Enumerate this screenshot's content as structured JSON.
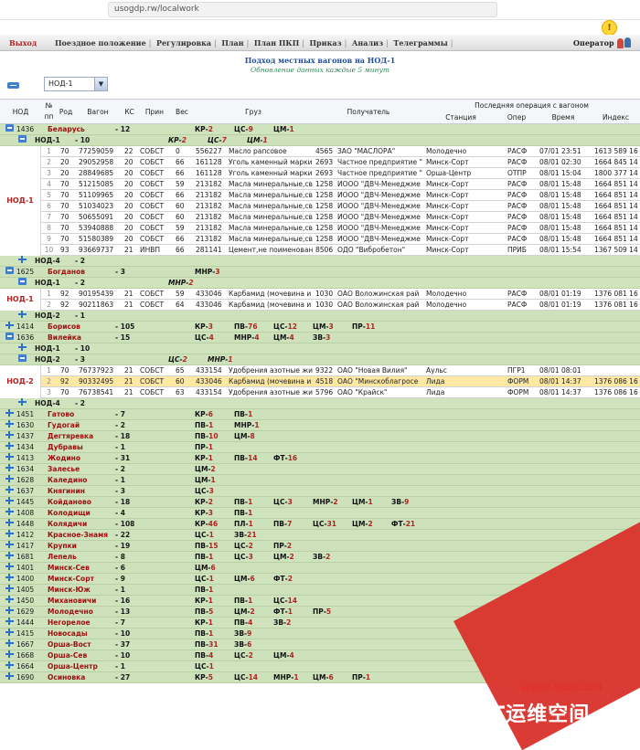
{
  "browser": {
    "url": "usogdp.rw/localwork"
  },
  "menu": {
    "exit": "Выход",
    "items": [
      "Поездное положение",
      "Регулировка",
      "План",
      "План ПКП",
      "Приказ",
      "Анализ",
      "Телеграммы"
    ],
    "operator": "Оператор"
  },
  "page": {
    "title": "Подход местных вагонов на НОД-1",
    "subtitle": "Обновление данных каждые 5 минут",
    "select_value": "НОД-1"
  },
  "table": {
    "headers": {
      "nod": "НОД",
      "no_line1": "№",
      "no_line2": "пп",
      "rod": "Род",
      "wagon": "Вагон",
      "ks": "КС",
      "prin": "Прин",
      "ves": "Вес",
      "gruz": "Груз",
      "recipient": "Получатель",
      "last_op": "Последняя операция с вагоном",
      "station": "Станция",
      "oper": "Опер",
      "time": "Время",
      "index": "Индекс"
    },
    "root": {
      "code": "1436",
      "name": "Беларусь",
      "count": "12",
      "codes": [
        [
          "КР",
          "2"
        ],
        [
          "ЦС",
          "9"
        ],
        [
          "ЦМ",
          "1"
        ]
      ]
    },
    "nod1": [
      {
        "label": "НОД-1",
        "count": "10",
        "codes": [
          [
            "КР",
            "2"
          ],
          [
            "ЦС",
            "7"
          ],
          [
            "ЦМ",
            "1"
          ]
        ],
        "expanded": true,
        "wagons": [
          {
            "n": "1",
            "rod": "70",
            "wagon": "77259059",
            "ks": "22",
            "prin": "СОБСТ",
            "ves": "0",
            "cargo_code": "556227",
            "cargo": "Масло рапсовое",
            "rcp_code": "4565",
            "recipient": "ЗАО \"МАСЛОРА\"",
            "station": "Молодечно",
            "op": "РАСФ",
            "time": "07/01 23:51",
            "index": "1613 589 16"
          },
          {
            "n": "2",
            "rod": "20",
            "wagon": "29052958",
            "ks": "20",
            "prin": "СОБСТ",
            "ves": "66",
            "cargo_code": "161128",
            "cargo": "Уголь каменный марки",
            "rcp_code": "2693",
            "recipient": "Частное предприятие \"",
            "station": "Минск-Сорт",
            "op": "РАСФ",
            "time": "08/01 02:30",
            "index": "1664 845 14"
          },
          {
            "n": "3",
            "rod": "20",
            "wagon": "28849685",
            "ks": "20",
            "prin": "СОБСТ",
            "ves": "66",
            "cargo_code": "161128",
            "cargo": "Уголь каменный марки",
            "rcp_code": "2693",
            "recipient": "Частное предприятие \"",
            "station": "Орша-Центр",
            "op": "ОТПР",
            "time": "08/01 15:04",
            "index": "1800 377 14"
          },
          {
            "n": "4",
            "rod": "70",
            "wagon": "51215085",
            "ks": "20",
            "prin": "СОБСТ",
            "ves": "59",
            "cargo_code": "213182",
            "cargo": "Масла минеральные,св",
            "rcp_code": "1258",
            "recipient": "ИООО \"ДВЧ-Менеджме",
            "station": "Минск-Сорт",
            "op": "РАСФ",
            "time": "08/01 15:48",
            "index": "1664 851 14"
          },
          {
            "n": "5",
            "rod": "70",
            "wagon": "51109965",
            "ks": "20",
            "prin": "СОБСТ",
            "ves": "66",
            "cargo_code": "213182",
            "cargo": "Масла минеральные,св",
            "rcp_code": "1258",
            "recipient": "ИООО \"ДВЧ-Менеджме",
            "station": "Минск-Сорт",
            "op": "РАСФ",
            "time": "08/01 15:48",
            "index": "1664 851 14"
          },
          {
            "n": "6",
            "rod": "70",
            "wagon": "51034023",
            "ks": "20",
            "prin": "СОБСТ",
            "ves": "60",
            "cargo_code": "213182",
            "cargo": "Масла минеральные,св",
            "rcp_code": "1258",
            "recipient": "ИООО \"ДВЧ-Менеджме",
            "station": "Минск-Сорт",
            "op": "РАСФ",
            "time": "08/01 15:48",
            "index": "1664 851 14"
          },
          {
            "n": "7",
            "rod": "70",
            "wagon": "50655091",
            "ks": "20",
            "prin": "СОБСТ",
            "ves": "60",
            "cargo_code": "213182",
            "cargo": "Масла минеральные,св",
            "rcp_code": "1258",
            "recipient": "ИООО \"ДВЧ-Менеджме",
            "station": "Минск-Сорт",
            "op": "РАСФ",
            "time": "08/01 15:48",
            "index": "1664 851 14"
          },
          {
            "n": "8",
            "rod": "70",
            "wagon": "53940888",
            "ks": "20",
            "prin": "СОБСТ",
            "ves": "59",
            "cargo_code": "213182",
            "cargo": "Масла минеральные,св",
            "rcp_code": "1258",
            "recipient": "ИООО \"ДВЧ-Менеджме",
            "station": "Минск-Сорт",
            "op": "РАСФ",
            "time": "08/01 15:48",
            "index": "1664 851 14"
          },
          {
            "n": "9",
            "rod": "70",
            "wagon": "51580389",
            "ks": "20",
            "prin": "СОБСТ",
            "ves": "66",
            "cargo_code": "213182",
            "cargo": "Масла минеральные,св",
            "rcp_code": "1258",
            "recipient": "ИООО \"ДВЧ-Менеджме",
            "station": "Минск-Сорт",
            "op": "РАСФ",
            "time": "08/01 15:48",
            "index": "1664 851 14"
          },
          {
            "n": "10",
            "rod": "93",
            "wagon": "93669737",
            "ks": "21",
            "prin": "ИНВП",
            "ves": "66",
            "cargo_code": "281141",
            "cargo": "Цемент,не поименован",
            "rcp_code": "8506",
            "recipient": "ОДО \"Вибробетон\"",
            "station": "Минск-Сорт",
            "op": "ПРИБ",
            "time": "08/01 15:54",
            "index": "1367 509 14"
          }
        ]
      },
      {
        "label": "НОД-4",
        "count": "2",
        "expanded": false
      }
    ],
    "bogdanov": {
      "code": "1625",
      "name": "Богданов",
      "count": "3",
      "codes": [
        [
          "МНР",
          "3"
        ]
      ]
    },
    "nod1b": [
      {
        "label": "НОД-1",
        "count": "2",
        "codes": [
          [
            "МНР",
            "2"
          ]
        ],
        "expanded": true,
        "wagons": [
          {
            "n": "1",
            "rod": "92",
            "wagon": "90195439",
            "ks": "21",
            "prin": "СОБСТ",
            "ves": "59",
            "cargo_code": "433046",
            "cargo": "Карбамид (мочевина и",
            "rcp_code": "1030",
            "recipient": "ОАО Воложинская рай",
            "station": "Молодечно",
            "op": "РАСФ",
            "time": "08/01 01:19",
            "index": "1376 081 16"
          },
          {
            "n": "2",
            "rod": "92",
            "wagon": "90211863",
            "ks": "21",
            "prin": "СОБСТ",
            "ves": "64",
            "cargo_code": "433046",
            "cargo": "Карбамид (мочевина и",
            "rcp_code": "1030",
            "recipient": "ОАО Воложинская рай",
            "station": "Молодечно",
            "op": "РАСФ",
            "time": "08/01 01:19",
            "index": "1376 081 16"
          }
        ]
      },
      {
        "label": "НОД-2",
        "count": "1",
        "expanded": false
      }
    ],
    "borisov": [
      {
        "code": "1414",
        "name": "Борисов",
        "count": "105",
        "codes": [
          [
            "КР",
            "3"
          ],
          [
            "ПВ",
            "76"
          ],
          [
            "ЦС",
            "12"
          ],
          [
            "ЦМ",
            "3"
          ],
          [
            "ПР",
            "11"
          ]
        ]
      },
      {
        "code": "1636",
        "name": "Вилейка",
        "count": "15",
        "codes": [
          [
            "ЦС",
            "4"
          ],
          [
            "МНР",
            "4"
          ],
          [
            "ЦМ",
            "4"
          ],
          [
            "ЗВ",
            "3"
          ]
        ]
      }
    ],
    "nod1c": {
      "label": "НОД-1",
      "count": "10"
    },
    "nod2": {
      "label": "НОД-2",
      "count": "3",
      "codes": [
        [
          "ЦС",
          "2"
        ],
        [
          "МНР",
          "1"
        ]
      ],
      "side": "НОД-2",
      "wagons": [
        {
          "n": "1",
          "rod": "70",
          "wagon": "76737923",
          "ks": "21",
          "prin": "СОБСТ",
          "ves": "65",
          "cargo_code": "433154",
          "cargo": "Удобрения азотные жи",
          "rcp_code": "9322",
          "recipient": "ОАО \"Новая Вилия\"",
          "station": "Аульс",
          "op": "ПГР1",
          "time": "08/01 08:01",
          "index": ""
        },
        {
          "n": "2",
          "rod": "92",
          "wagon": "90332495",
          "ks": "21",
          "prin": "СОБСТ",
          "ves": "60",
          "cargo_code": "433046",
          "cargo": "Карбамид (мочевина и",
          "rcp_code": "4518",
          "recipient": "ОАО \"Минскоблагросе",
          "station": "Лида",
          "op": "ФОРМ",
          "time": "08/01 14:37",
          "index": "1376 086 16",
          "highlight": true
        },
        {
          "n": "3",
          "rod": "70",
          "wagon": "76738541",
          "ks": "21",
          "prin": "СОБСТ",
          "ves": "63",
          "cargo_code": "433154",
          "cargo": "Удобрения азотные жи",
          "rcp_code": "5796",
          "recipient": "ОАО \"Крайск\"",
          "station": "Лида",
          "op": "ФОРМ",
          "time": "08/01 14:37",
          "index": "1376 086 16"
        }
      ]
    },
    "nod4b": {
      "label": "НОД-4",
      "count": "2"
    },
    "stations": [
      {
        "code": "1451",
        "name": "Гатово",
        "count": "7",
        "codes": [
          [
            "КР",
            "6"
          ],
          [
            "ПВ",
            "1"
          ]
        ]
      },
      {
        "code": "1630",
        "name": "Гудогай",
        "count": "2",
        "codes": [
          [
            "ПВ",
            "1"
          ],
          [
            "МНР",
            "1"
          ]
        ]
      },
      {
        "code": "1437",
        "name": "Дегтяревка",
        "count": "18",
        "codes": [
          [
            "ПВ",
            "10"
          ],
          [
            "ЦМ",
            "8"
          ]
        ]
      },
      {
        "code": "1434",
        "name": "Дубравы",
        "count": "1",
        "codes": [
          [
            "ПР",
            "1"
          ]
        ]
      },
      {
        "code": "1413",
        "name": "Жодино",
        "count": "31",
        "codes": [
          [
            "КР",
            "1"
          ],
          [
            "ПВ",
            "14"
          ],
          [
            "ФТ",
            "16"
          ]
        ]
      },
      {
        "code": "1634",
        "name": "Залесье",
        "count": "2",
        "codes": [
          [
            "ЦМ",
            "2"
          ]
        ]
      },
      {
        "code": "1628",
        "name": "Каледино",
        "count": "1",
        "codes": [
          [
            "ЦМ",
            "1"
          ]
        ]
      },
      {
        "code": "1637",
        "name": "Княгинин",
        "count": "3",
        "codes": [
          [
            "ЦС",
            "3"
          ]
        ]
      },
      {
        "code": "1445",
        "name": "Койданово",
        "count": "18",
        "codes": [
          [
            "КР",
            "2"
          ],
          [
            "ПВ",
            "1"
          ],
          [
            "ЦС",
            "3"
          ],
          [
            "МНР",
            "2"
          ],
          [
            "ЦМ",
            "1"
          ],
          [
            "ЗВ",
            "9"
          ]
        ]
      },
      {
        "code": "1408",
        "name": "Колодищи",
        "count": "4",
        "codes": [
          [
            "КР",
            "3"
          ],
          [
            "ПВ",
            "1"
          ]
        ]
      },
      {
        "code": "1448",
        "name": "Колядичи",
        "count": "108",
        "codes": [
          [
            "КР",
            "46"
          ],
          [
            "ПЛ",
            "1"
          ],
          [
            "ПВ",
            "7"
          ],
          [
            "ЦС",
            "31"
          ],
          [
            "ЦМ",
            "2"
          ],
          [
            "ФТ",
            "21"
          ]
        ]
      },
      {
        "code": "1412",
        "name": "Красное-Знамя",
        "count": "22",
        "codes": [
          [
            "ЦС",
            "1"
          ],
          [
            "ЗВ",
            "21"
          ]
        ]
      },
      {
        "code": "1417",
        "name": "Крупки",
        "count": "19",
        "codes": [
          [
            "ПВ",
            "15"
          ],
          [
            "ЦС",
            "2"
          ],
          [
            "ПР",
            "2"
          ]
        ]
      },
      {
        "code": "1681",
        "name": "Лепель",
        "count": "8",
        "codes": [
          [
            "ПВ",
            "1"
          ],
          [
            "ЦС",
            "3"
          ],
          [
            "ЦМ",
            "2"
          ],
          [
            "ЗВ",
            "2"
          ]
        ]
      },
      {
        "code": "1401",
        "name": "Минск-Сев",
        "count": "6",
        "codes": [
          [
            "ЦМ",
            "6"
          ]
        ]
      },
      {
        "code": "1400",
        "name": "Минск-Сорт",
        "count": "9",
        "codes": [
          [
            "ЦС",
            "1"
          ],
          [
            "ЦМ",
            "6"
          ],
          [
            "ФТ",
            "2"
          ]
        ]
      },
      {
        "code": "1405",
        "name": "Минск-Юж",
        "count": "1",
        "codes": [
          [
            "ПВ",
            "1"
          ]
        ]
      },
      {
        "code": "1450",
        "name": "Михановичи",
        "count": "16",
        "codes": [
          [
            "КР",
            "1"
          ],
          [
            "ПВ",
            "1"
          ],
          [
            "ЦС",
            "14"
          ]
        ]
      },
      {
        "code": "1629",
        "name": "Молодечно",
        "count": "13",
        "codes": [
          [
            "ПВ",
            "5"
          ],
          [
            "ЦМ",
            "2"
          ],
          [
            "ФТ",
            "1"
          ],
          [
            "ПР",
            "5"
          ]
        ]
      },
      {
        "code": "1444",
        "name": "Негорелое",
        "count": "7",
        "codes": [
          [
            "КР",
            "1"
          ],
          [
            "ПВ",
            "4"
          ],
          [
            "ЗВ",
            "2"
          ]
        ]
      },
      {
        "code": "1415",
        "name": "Новосады",
        "count": "10",
        "codes": [
          [
            "ПВ",
            "1"
          ],
          [
            "ЗВ",
            "9"
          ]
        ]
      },
      {
        "code": "1667",
        "name": "Орша-Вост",
        "count": "37",
        "codes": [
          [
            "ПВ",
            "31"
          ],
          [
            "ЗВ",
            "6"
          ]
        ]
      },
      {
        "code": "1668",
        "name": "Орша-Сев",
        "count": "10",
        "codes": [
          [
            "ПВ",
            "4"
          ],
          [
            "ЦС",
            "2"
          ],
          [
            "ЦМ",
            "4"
          ]
        ]
      },
      {
        "code": "1664",
        "name": "Орша-Центр",
        "count": "1",
        "codes": [
          [
            "ЦС",
            "1"
          ]
        ]
      },
      {
        "code": "1690",
        "name": "Осиновка",
        "count": "27",
        "codes": [
          [
            "КР",
            "5"
          ],
          [
            "ЦС",
            "14"
          ],
          [
            "МНР",
            "1"
          ],
          [
            "ЦМ",
            "6"
          ],
          [
            "ПР",
            "1"
          ]
        ]
      }
    ]
  },
  "watermark": {
    "line1": "WWW.94IP.COM",
    "line2": "IT运维空间"
  }
}
